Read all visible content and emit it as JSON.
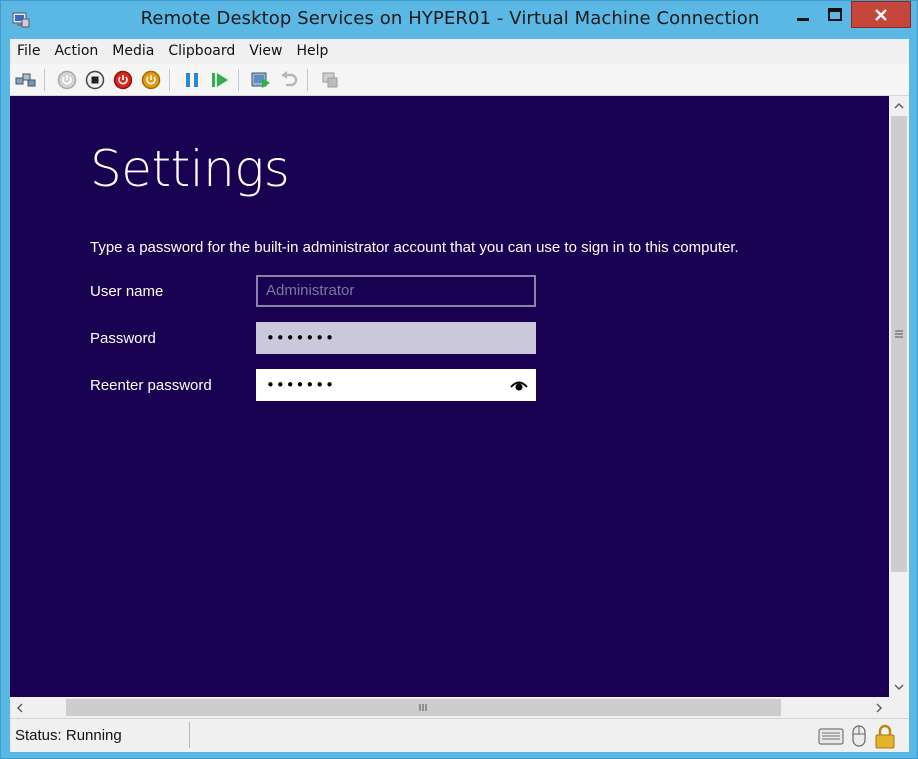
{
  "window": {
    "title": "Remote Desktop Services on HYPER01 - Virtual Machine Connection"
  },
  "menu": {
    "items": [
      "File",
      "Action",
      "Media",
      "Clipboard",
      "View",
      "Help"
    ]
  },
  "toolbar": {
    "icons": [
      "ctrl-alt-del-icon",
      "start-icon",
      "turn-off-icon",
      "shut-down-icon",
      "power-icon",
      "pause-icon",
      "resume-icon",
      "checkpoint-icon",
      "revert-icon",
      "enhanced-session-icon"
    ]
  },
  "screen": {
    "title": "Settings",
    "instructions": "Type a password for the built-in administrator account that you can use to sign in to this computer.",
    "user_label": "User name",
    "user_value": "Administrator",
    "password_label": "Password",
    "password_value": "•••••••",
    "reenter_label": "Reenter password",
    "reenter_value": "•••••••",
    "background": "#1a0050"
  },
  "status": {
    "text": "Status: Running"
  }
}
